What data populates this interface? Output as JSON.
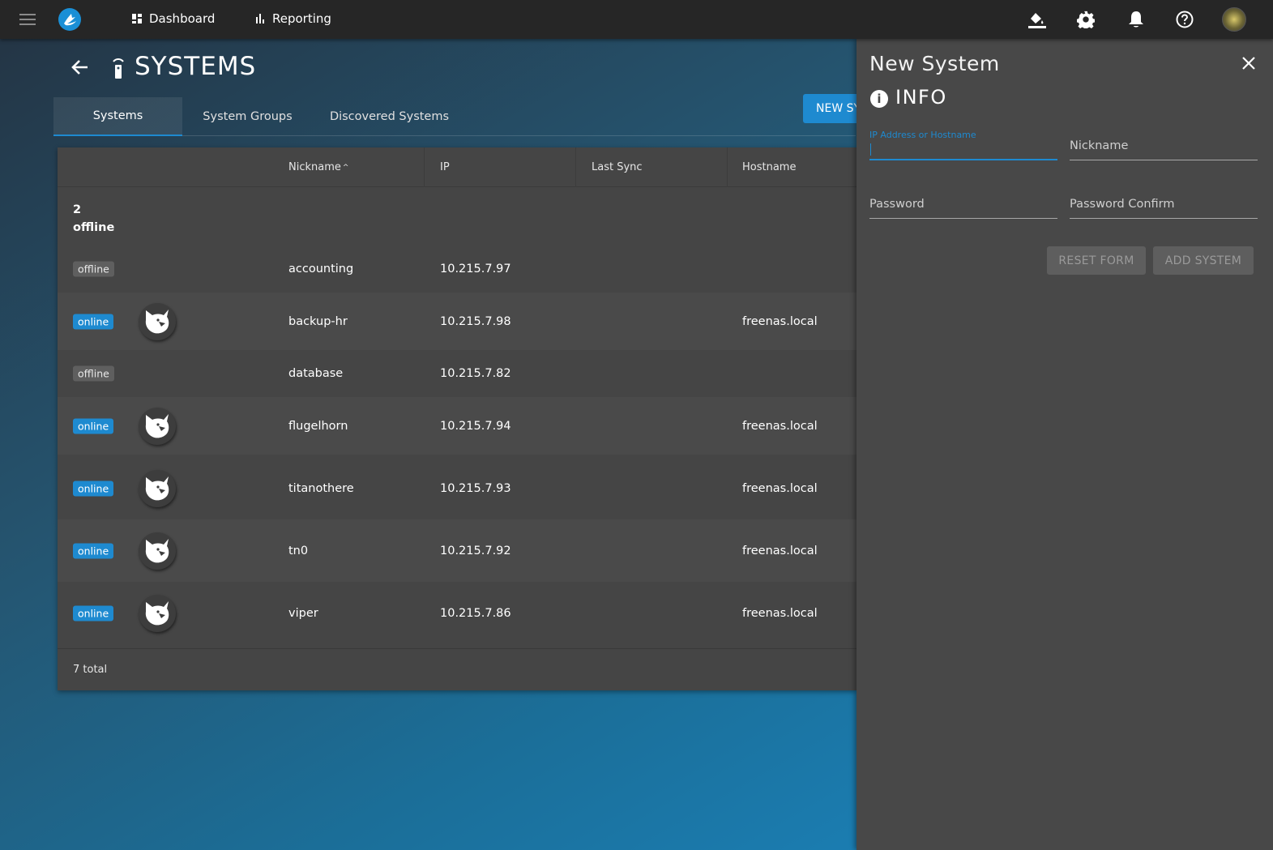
{
  "topbar": {
    "nav": [
      {
        "label": "Dashboard",
        "icon": "dashboard-icon"
      },
      {
        "label": "Reporting",
        "icon": "bar-chart-icon"
      }
    ],
    "icons": [
      "paint-bucket-icon",
      "gear-icon",
      "bell-icon",
      "help-icon"
    ]
  },
  "page": {
    "title": "SYSTEMS",
    "new_button": "NEW SYSTEM",
    "tabs": [
      {
        "label": "Systems",
        "active": true
      },
      {
        "label": "System Groups",
        "active": false
      },
      {
        "label": "Discovered Systems",
        "active": false
      }
    ]
  },
  "table": {
    "columns": [
      "Nickname",
      "IP",
      "Last Sync",
      "Hostname"
    ],
    "sort_indicator": "^",
    "group": {
      "count": "2",
      "label": "offline"
    },
    "rows": [
      {
        "status": "offline",
        "nickname": "accounting",
        "ip": "10.215.7.97",
        "last_sync": "",
        "hostname": ""
      },
      {
        "status": "online",
        "nickname": "backup-hr",
        "ip": "10.215.7.98",
        "last_sync": "",
        "hostname": "freenas.local"
      },
      {
        "status": "offline",
        "nickname": "database",
        "ip": "10.215.7.82",
        "last_sync": "",
        "hostname": ""
      },
      {
        "status": "online",
        "nickname": "flugelhorn",
        "ip": "10.215.7.94",
        "last_sync": "",
        "hostname": "freenas.local"
      },
      {
        "status": "online",
        "nickname": "titanothere",
        "ip": "10.215.7.93",
        "last_sync": "",
        "hostname": "freenas.local"
      },
      {
        "status": "online",
        "nickname": "tn0",
        "ip": "10.215.7.92",
        "last_sync": "",
        "hostname": "freenas.local"
      },
      {
        "status": "online",
        "nickname": "viper",
        "ip": "10.215.7.86",
        "last_sync": "",
        "hostname": "freenas.local"
      }
    ],
    "footer": "7 total"
  },
  "panel": {
    "title": "New System",
    "section": "INFO",
    "fields": {
      "ip_label": "IP Address or Hostname",
      "ip_value": "",
      "nickname_label": "Nickname",
      "password_label": "Password",
      "password_confirm_label": "Password Confirm"
    },
    "reset_button": "RESET FORM",
    "add_button": "ADD SYSTEM"
  },
  "colors": {
    "accent": "#1e8ad0",
    "panel": "#484848",
    "topbar": "#262626"
  }
}
